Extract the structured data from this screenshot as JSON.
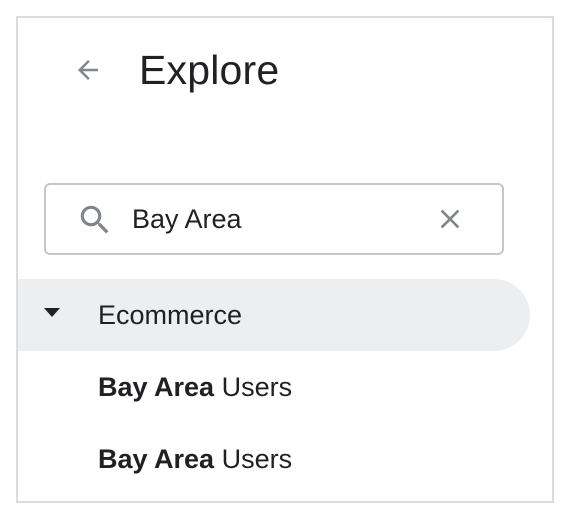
{
  "header": {
    "back_icon": "arrow-back-icon",
    "title": "Explore"
  },
  "search": {
    "icon": "search-icon",
    "value": "Bay Area",
    "clear_icon": "close-icon"
  },
  "tree": {
    "group": {
      "label": "Ecommerce",
      "expanded": true,
      "caret_icon": "caret-down-icon"
    },
    "items": [
      {
        "match": "Bay Area",
        "rest": " Users"
      },
      {
        "match": "Bay Area",
        "rest": " Users"
      }
    ]
  },
  "colors": {
    "text": "#202124",
    "icon": "#80868b",
    "border": "#c4c7ca",
    "group_bg": "#eceeef"
  }
}
